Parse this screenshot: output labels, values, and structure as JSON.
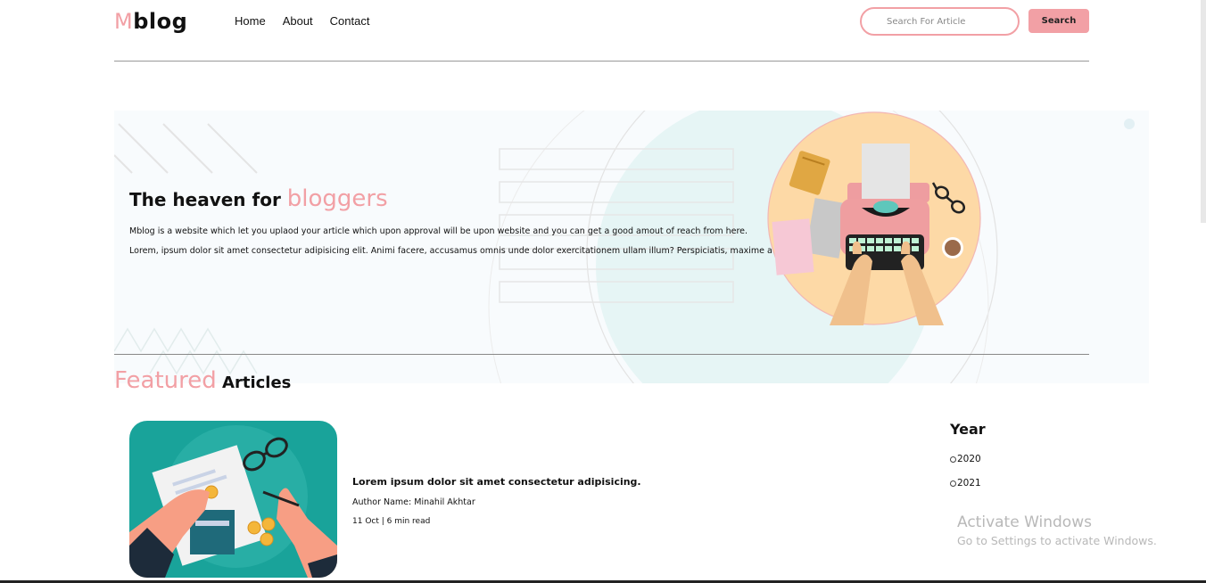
{
  "nav": {
    "logo_m": "M",
    "logo_rest": "blog",
    "links": [
      "Home",
      "About",
      "Contact"
    ],
    "search_placeholder": "Search For Article",
    "search_button": "Search"
  },
  "hero": {
    "title_prefix": "The heaven for ",
    "title_accent": "bloggers",
    "paragraph1": "Mblog is a website which let you uplaod your article which upon approval will be upon website and you can get a good amout of reach from here.",
    "paragraph2": "Lorem, ipsum dolor sit amet consectetur adipisicing elit. Animi facere, accusamus omnis unde dolor exercitationem ullam illum? Perspiciatis, maxime atque!"
  },
  "featured": {
    "heading_accent": "Featured",
    "heading_rest": " Articles"
  },
  "article": {
    "title": "Lorem ipsum dolor sit amet consectetur adipisicing.",
    "author": "Author Name: Minahil Akhtar",
    "meta": "11 Oct | 6 min read"
  },
  "filter": {
    "heading": "Year",
    "options": [
      "2020",
      "2021"
    ]
  },
  "watermark": {
    "line1": "Activate Windows",
    "line2": "Go to Settings to activate Windows."
  },
  "colors": {
    "accent": "#f2a0a5",
    "teal": "#19a39a",
    "illustration_bg": "#fdd9a6"
  }
}
